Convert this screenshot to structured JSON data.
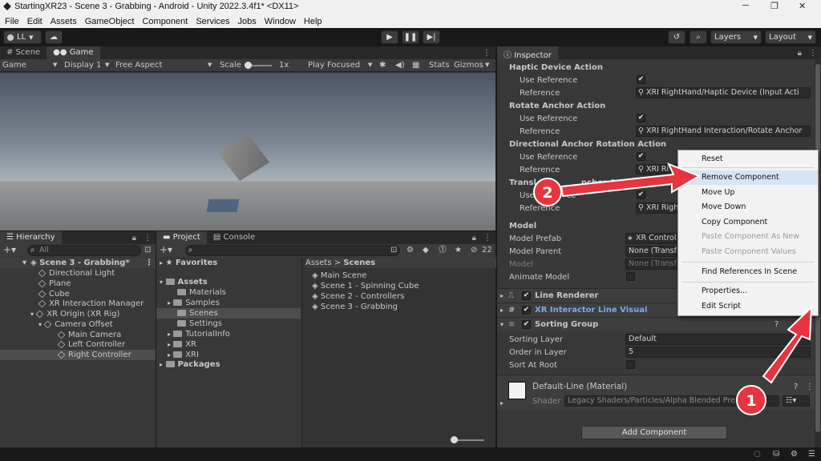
{
  "window": {
    "title": "StartingXR23 - Scene 3 - Grabbing - Android - Unity 2022.3.4f1* <DX11>"
  },
  "menubar": [
    "File",
    "Edit",
    "Assets",
    "GameObject",
    "Component",
    "Services",
    "Jobs",
    "Window",
    "Help"
  ],
  "toolbar": {
    "account": "LL",
    "layers": "Layers",
    "layout": "Layout"
  },
  "scene_tabs": {
    "scene": "Scene",
    "game": "Game"
  },
  "game_bar": {
    "mode": "Game",
    "display": "Display 1",
    "aspect": "Free Aspect",
    "scale_label": "Scale",
    "scale_value": "1x",
    "play_mode": "Play Focused",
    "stats": "Stats",
    "gizmos": "Gizmos"
  },
  "hierarchy": {
    "tab": "Hierarchy",
    "search_placeholder": "All",
    "items": [
      "Scene 3 - Grabbing*",
      "Directional Light",
      "Plane",
      "Cube",
      "XR Interaction Manager",
      "XR Origin (XR Rig)",
      "Camera Offset",
      "Main Camera",
      "Left Controller",
      "Right Controller"
    ]
  },
  "project": {
    "tab_project": "Project",
    "tab_console": "Console",
    "count": "22",
    "favorites": "Favorites",
    "assets": "Assets",
    "folders": [
      "Materials",
      "Samples",
      "Scenes",
      "Settings",
      "TutorialInfo",
      "XR",
      "XRI"
    ],
    "packages": "Packages",
    "breadcrumb_root": "Assets",
    "breadcrumb_sep": ">",
    "breadcrumb_current": "Scenes",
    "files": [
      "Main Scene",
      "Scene 1 - Spinning Cube",
      "Scene 2 - Controllers",
      "Scene 3 - Grabbing"
    ]
  },
  "inspector": {
    "tab": "Inspector",
    "haptic": {
      "header": "Haptic Device Action",
      "use_ref": "Use Reference",
      "ref_label": "Reference",
      "ref_value": "XRI RightHand/Haptic Device (Input Acti"
    },
    "rotate": {
      "header": "Rotate Anchor Action",
      "use_ref": "Use Reference",
      "ref_label": "Reference",
      "ref_value": "XRI RightHand Interaction/Rotate Anchor"
    },
    "directional": {
      "header": "Directional Anchor Rotation Action",
      "use_ref": "Use Reference",
      "ref_label": "Reference",
      "ref_value": "XRI Ri"
    },
    "translate": {
      "header_a": "Transl",
      "header_b": "nchor Acti",
      "use_ref_a": "Use",
      "use_ref_b": "ce",
      "ref_label": "Reference",
      "ref_value": "XRI Righ"
    },
    "model": {
      "header": "Model",
      "prefab_label": "Model Prefab",
      "prefab_value": "XR Control",
      "parent_label": "Model Parent",
      "parent_value": "None (Transf",
      "model_label": "Model",
      "model_value": "None (Transf",
      "animate_label": "Animate Model"
    },
    "components": [
      "Line Renderer",
      "XR Interactor Line Visual",
      "Sorting Group"
    ],
    "sorting": {
      "layer_label": "Sorting Layer",
      "layer_value": "Default",
      "order_label": "Order in Layer",
      "order_value": "5",
      "root_label": "Sort At Root"
    },
    "material": {
      "name": "Default-Line (Material)",
      "shader_label": "Shader",
      "shader_value": "Legacy Shaders/Particles/Alpha Blended Pre"
    },
    "add_component": "Add Component"
  },
  "context_menu": {
    "items": [
      "Reset",
      "Remove Component",
      "Move Up",
      "Move Down",
      "Copy Component",
      "Paste Component As New",
      "Paste Component Values",
      "Find References In Scene",
      "Properties...",
      "Edit Script"
    ]
  },
  "annotations": {
    "step1": "1",
    "step2": "2",
    "arrow_color": "#e8343f"
  },
  "colors": {
    "accent": "#4c7fd6",
    "panel": "#383838"
  }
}
